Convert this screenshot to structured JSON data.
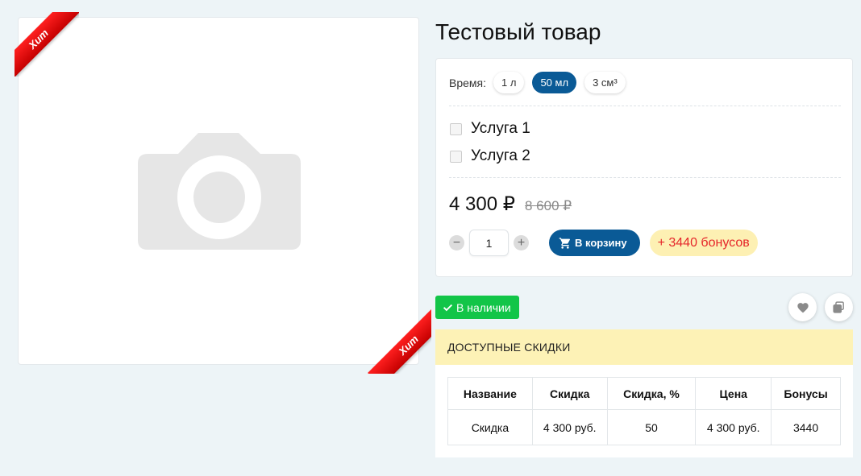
{
  "product": {
    "title": "Тестовый товар",
    "badges": {
      "top_left": "Хит",
      "bottom_right": "Хит"
    }
  },
  "options": {
    "time_label": "Время:",
    "time_options": [
      "1 л",
      "50 мл",
      "3 см³"
    ],
    "selected_time": "50 мл",
    "services": [
      "Услуга 1",
      "Услуга 2"
    ]
  },
  "pricing": {
    "price": "4 300 ₽",
    "old_price": "8 600 ₽",
    "quantity": "1",
    "cart_label": "В корзину",
    "bonus_label": "+ 3440 бонусов"
  },
  "stock": {
    "label": "В наличии"
  },
  "discounts": {
    "header": "ДОСТУПНЫЕ СКИДКИ",
    "columns": [
      "Название",
      "Скидка",
      "Скидка, %",
      "Цена",
      "Бонусы"
    ],
    "rows": [
      [
        "Скидка",
        "4 300 руб.",
        "50",
        "4 300 руб.",
        "3440"
      ]
    ]
  },
  "colors": {
    "primary": "#0a5a96",
    "stock_green": "#12c548",
    "bonus_bg": "#fdf0b3",
    "bonus_text": "#e5262a",
    "ribbon_red": "#e01010",
    "discount_header_bg": "#fdf2b6"
  },
  "icons": [
    "camera-icon",
    "cart-icon",
    "check-icon",
    "heart-icon",
    "compare-icon",
    "minus-icon",
    "plus-icon"
  ]
}
